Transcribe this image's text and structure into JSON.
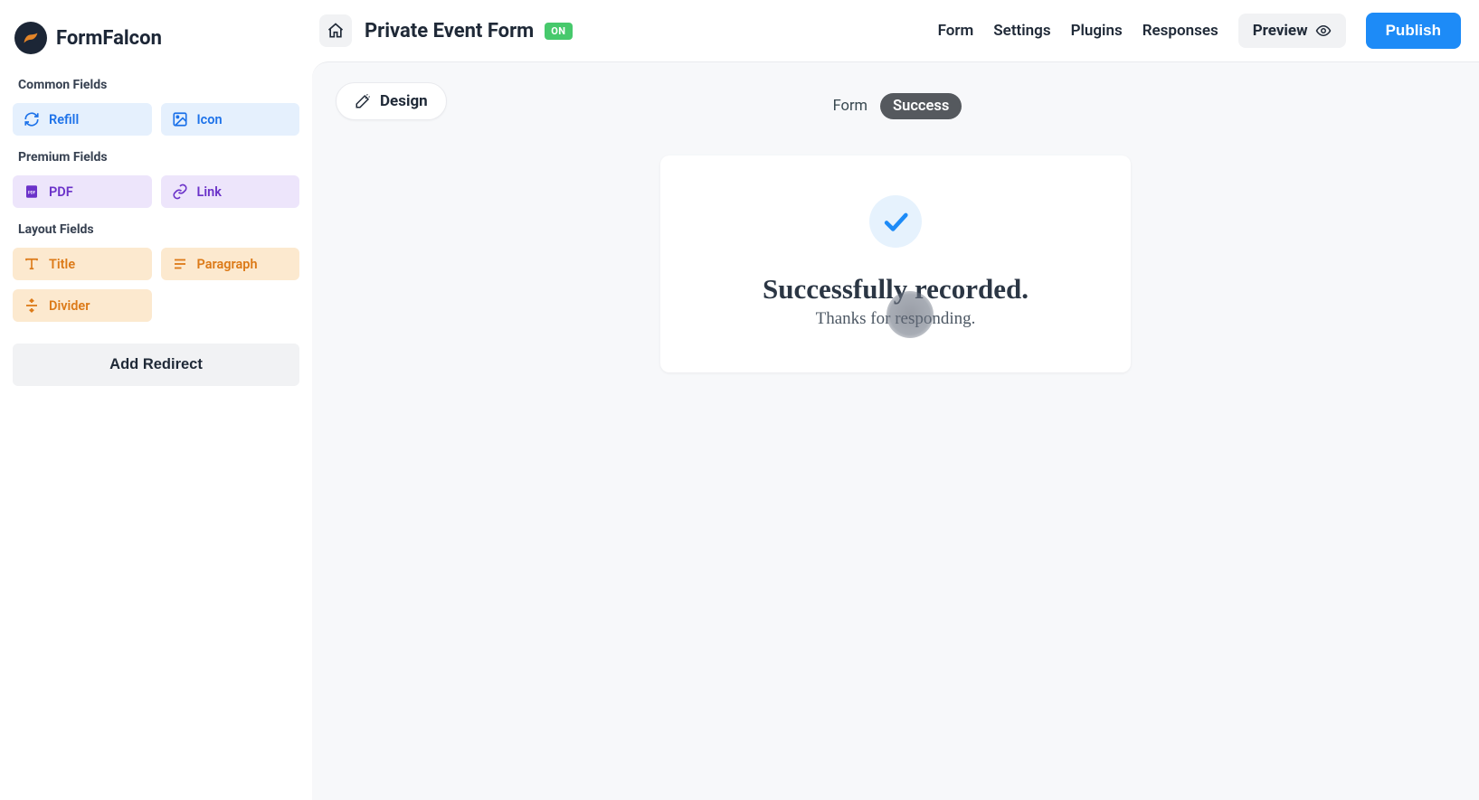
{
  "brand": {
    "name": "FormFalcon"
  },
  "sidebar": {
    "sections": {
      "common": {
        "label": "Common Fields",
        "items": [
          "Refill",
          "Icon"
        ]
      },
      "premium": {
        "label": "Premium Fields",
        "items": [
          "PDF",
          "Link"
        ]
      },
      "layout": {
        "label": "Layout Fields",
        "items": [
          "Title",
          "Paragraph",
          "Divider"
        ]
      }
    },
    "add_redirect": "Add Redirect"
  },
  "topbar": {
    "title": "Private Event Form",
    "status": "ON",
    "nav": [
      "Form",
      "Settings",
      "Plugins",
      "Responses"
    ],
    "preview": "Preview",
    "publish": "Publish"
  },
  "canvas": {
    "design_chip": "Design",
    "mode_tabs": {
      "form": "Form",
      "success": "Success",
      "active": "success"
    },
    "success_card": {
      "title": "Successfully recorded.",
      "subtitle": "Thanks for responding."
    }
  }
}
